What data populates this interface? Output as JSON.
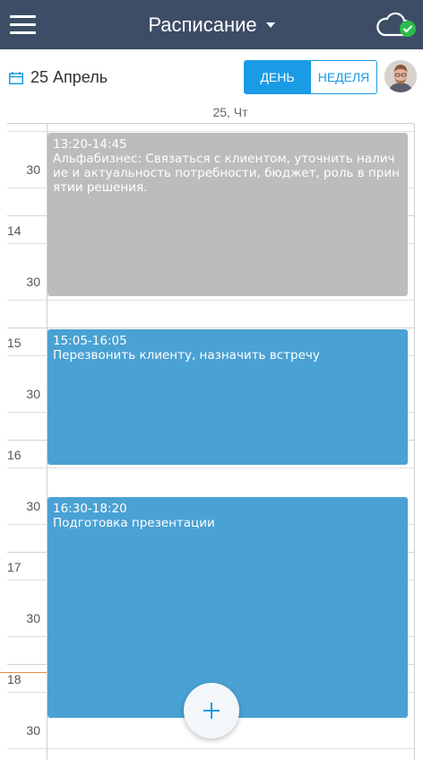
{
  "header": {
    "title": "Расписание",
    "menu_icon": "hamburger-menu-icon",
    "sync_icon": "cloud-sync-ok-icon",
    "colors": {
      "bar": "#3d4d66",
      "sync_ok": "#2bbd4a"
    }
  },
  "toolbar": {
    "date": "25 Апрель",
    "calendar_icon": "calendar-icon",
    "view_day": "ДЕНЬ",
    "view_week": "НЕДЕЛЯ",
    "active_view": "day",
    "accent": "#1a9be6"
  },
  "day_header": "25, Чт",
  "time_labels": {
    "h14": "14",
    "h15": "15",
    "h16": "16",
    "h17": "17",
    "h18": "18",
    "m30": "30"
  },
  "events": [
    {
      "time": "13:20-14:45",
      "text": "Альфабизнес: Связаться с клиентом, уточнить наличие и актуальность потребности, бюджет, роль в принятии решения.",
      "color": "#bcbcbc"
    },
    {
      "time": "15:05-16:05",
      "text": "Перезвонить клиенту, назначить встречу",
      "color": "#4aa1d3"
    },
    {
      "time": "16:30-18:20",
      "text": "Подготовка презентации",
      "color": "#4aa1d3"
    }
  ],
  "fab": {
    "icon": "plus-icon"
  }
}
